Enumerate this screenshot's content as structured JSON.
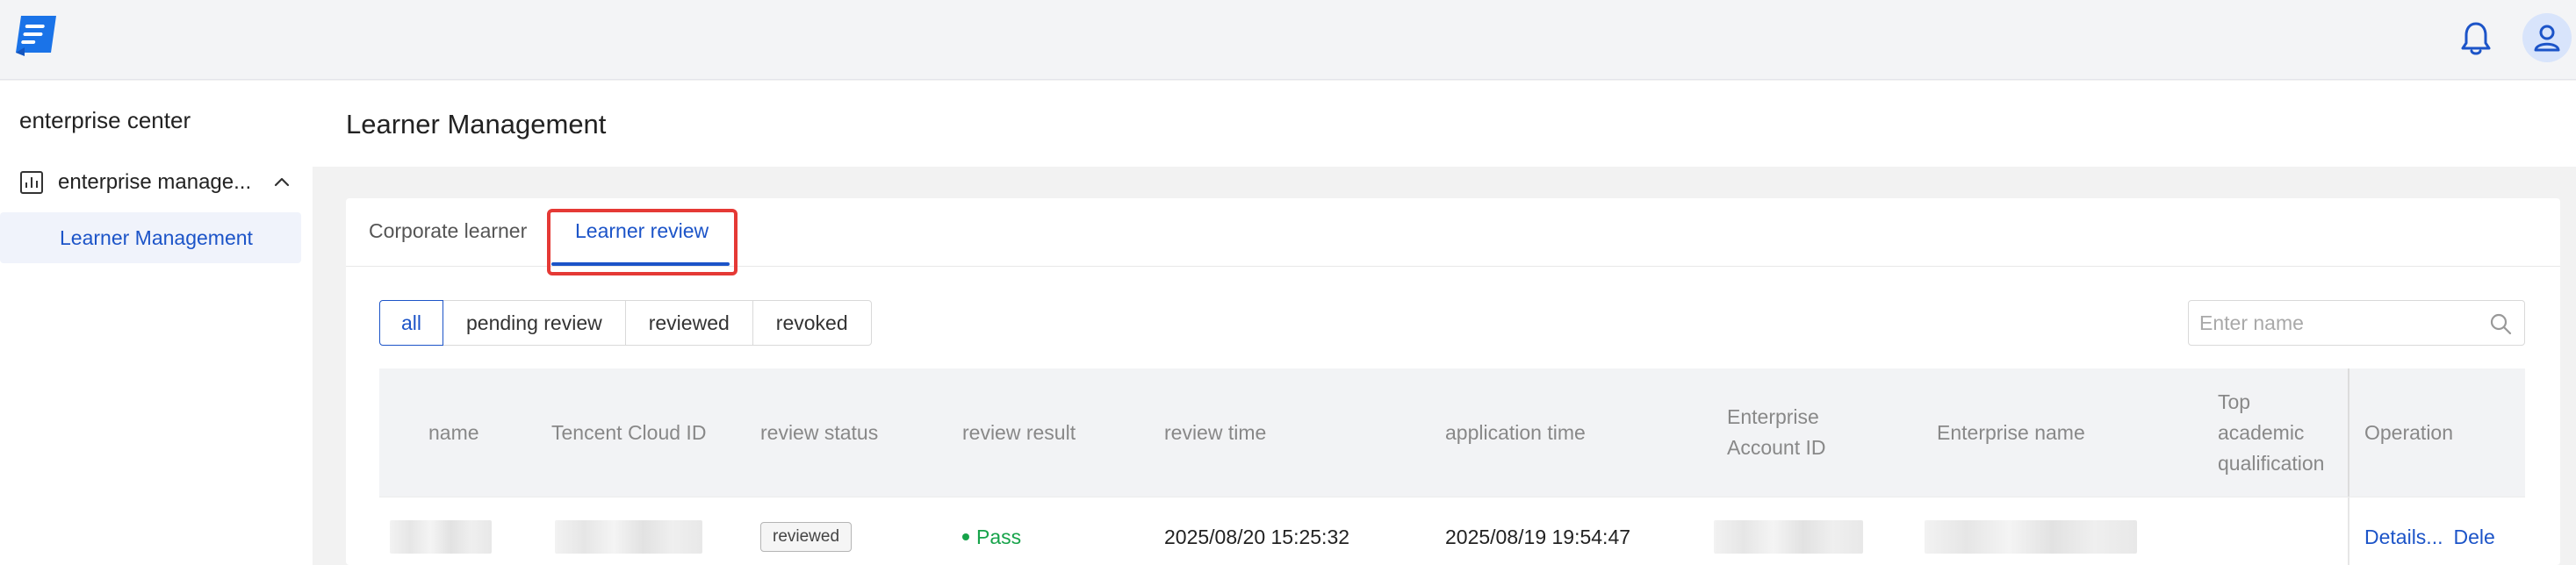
{
  "sidebar": {
    "title": "enterprise center",
    "group": {
      "label": "enterprise manage...",
      "icon": "bar-chart-icon",
      "expanded": true
    },
    "items": [
      {
        "label": "Learner Management",
        "active": true
      }
    ]
  },
  "header": {
    "icons": [
      "logo-icon",
      "bell-icon",
      "user-avatar-icon"
    ]
  },
  "page": {
    "title": "Learner Management"
  },
  "tabs": [
    {
      "label": "Corporate learner",
      "active": false
    },
    {
      "label": "Learner review",
      "active": true
    }
  ],
  "filters": [
    {
      "label": "all",
      "active": true
    },
    {
      "label": "pending review",
      "active": false
    },
    {
      "label": "reviewed",
      "active": false
    },
    {
      "label": "revoked",
      "active": false
    }
  ],
  "search": {
    "placeholder": "Enter name",
    "value": ""
  },
  "table": {
    "columns": [
      "name",
      "Tencent Cloud ID",
      "review status",
      "review result",
      "review time",
      "application time",
      "Enterprise Account ID",
      "Enterprise name",
      "Top academic qualification",
      "Operation"
    ],
    "rows": [
      {
        "name": "",
        "tencent_cloud_id": "",
        "review_status": "reviewed",
        "review_result": "Pass",
        "review_time": "2025/08/20 15:25:32",
        "application_time": "2025/08/19 19:54:47",
        "enterprise_account_id": "",
        "enterprise_name": "",
        "top_academic_qualification": "",
        "operations": [
          "Details...",
          "Dele"
        ]
      }
    ]
  },
  "colors": {
    "accent": "#1c54c8",
    "pass": "#16a34a",
    "highlight": "#e53935"
  }
}
